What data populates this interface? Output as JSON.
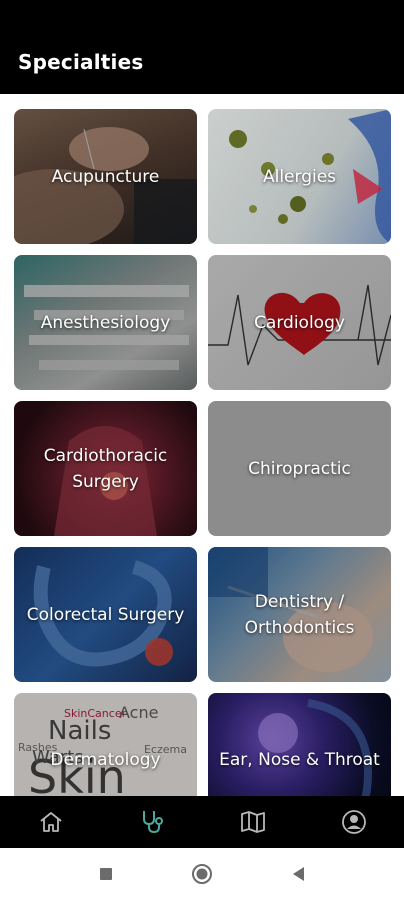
{
  "header": {
    "title": "Specialties"
  },
  "specialties": [
    {
      "label": "Acupuncture"
    },
    {
      "label": "Allergies"
    },
    {
      "label": "Anesthesiology"
    },
    {
      "label": "Cardiology"
    },
    {
      "label": "Cardiothoracic\nSurgery"
    },
    {
      "label": "Chiropractic"
    },
    {
      "label": "Colorectal Surgery"
    },
    {
      "label": "Dentistry /\nOrthodontics"
    },
    {
      "label": "Dermatology"
    },
    {
      "label": "Ear, Nose & Throat"
    }
  ],
  "dermatology_words": [
    "Nails",
    "Skin",
    "Acne",
    "Warts",
    "Rashes",
    "SkinCancer",
    "Eczema"
  ],
  "nav": {
    "items": [
      {
        "icon": "home-icon",
        "active": false
      },
      {
        "icon": "stethoscope-icon",
        "active": true
      },
      {
        "icon": "map-icon",
        "active": false
      },
      {
        "icon": "profile-icon",
        "active": false
      }
    ],
    "active_color": "#4fa89a",
    "inactive_color": "#b8b8b8"
  },
  "system_nav": [
    "recents-icon",
    "home-circle-icon",
    "back-icon"
  ]
}
